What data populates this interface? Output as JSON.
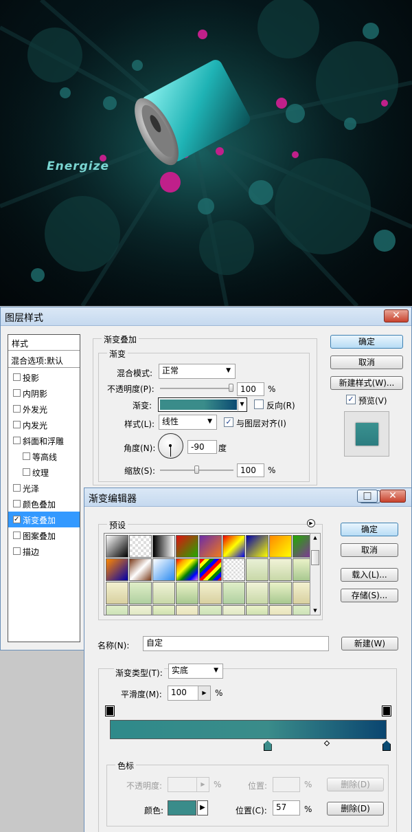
{
  "poster": {
    "text": "Energize"
  },
  "layer_style": {
    "title": "图层样式",
    "close": "✕",
    "styles_header": "样式",
    "blend_options": "混合选项:默认",
    "items": [
      {
        "label": "投影",
        "checked": false,
        "indent": false
      },
      {
        "label": "内阴影",
        "checked": false,
        "indent": false
      },
      {
        "label": "外发光",
        "checked": false,
        "indent": false
      },
      {
        "label": "内发光",
        "checked": false,
        "indent": false
      },
      {
        "label": "斜面和浮雕",
        "checked": false,
        "indent": false
      },
      {
        "label": "等高线",
        "checked": false,
        "indent": true
      },
      {
        "label": "纹理",
        "checked": false,
        "indent": true
      },
      {
        "label": "光泽",
        "checked": false,
        "indent": false
      },
      {
        "label": "颜色叠加",
        "checked": false,
        "indent": false
      },
      {
        "label": "渐变叠加",
        "checked": true,
        "indent": false,
        "selected": true
      },
      {
        "label": "图案叠加",
        "checked": false,
        "indent": false
      },
      {
        "label": "描边",
        "checked": false,
        "indent": false
      }
    ],
    "section_title": "渐变叠加",
    "sub_title": "渐变",
    "blend_mode_label": "混合模式:",
    "blend_mode_value": "正常",
    "opacity_label": "不透明度(P):",
    "opacity_value": "100",
    "opacity_fraction": 1.0,
    "percent": "%",
    "gradient_label": "渐变:",
    "reverse_label": "反向(R)",
    "style_label": "样式(L):",
    "style_value": "线性",
    "align_label": "与图层对齐(I)",
    "angle_label": "角度(N):",
    "angle_value": "-90",
    "degree": "度",
    "scale_label": "缩放(S):",
    "scale_value": "100",
    "scale_fraction": 0.5,
    "ok": "确定",
    "cancel": "取消",
    "new_style": "新建样式(W)...",
    "preview": "预览(V)",
    "preview_checked": true
  },
  "gradient_editor": {
    "title": "渐变编辑器",
    "presets_label": "预设",
    "ok": "确定",
    "cancel": "取消",
    "load": "载入(L)...",
    "save": "存储(S)...",
    "name_label": "名称(N):",
    "name_value": "自定",
    "new_button": "新建(W)",
    "gradient_type_label": "渐变类型(T):",
    "gradient_type_value": "实底",
    "smoothness_label": "平滑度(M):",
    "smoothness_value": "100",
    "percent": "%",
    "stops_title": "色标",
    "stop_opacity_label": "不透明度:",
    "stop_location_label": "位置:",
    "delete_label": "删除(D)",
    "color_label": "颜色:",
    "color_location_label": "位置(C):",
    "color_location_value": "57",
    "color_stops": [
      {
        "location": 57,
        "color": "#3a8c8a"
      },
      {
        "location": 100,
        "color": "#0a4a72"
      }
    ],
    "opacity_stops": [
      0,
      100
    ],
    "gradient_colors": [
      "#2f8a8a",
      "#0a4570"
    ]
  },
  "colors": {
    "selection": "#3399ff",
    "stop_color": "#3a8c8a"
  }
}
